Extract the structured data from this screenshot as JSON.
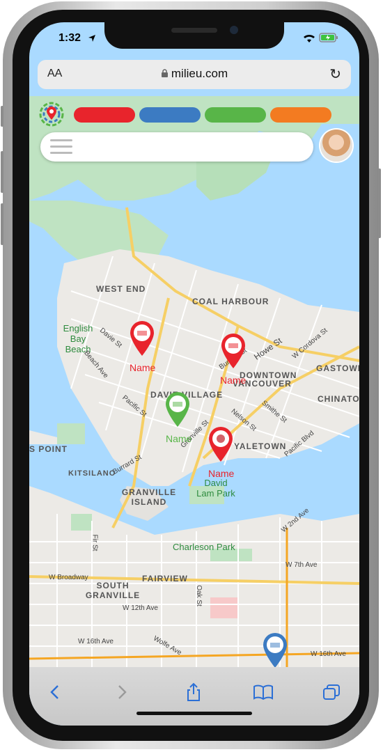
{
  "status_bar": {
    "time": "1:32"
  },
  "browser": {
    "text_size_label": "AA",
    "url": "milieu.com"
  },
  "filters": {
    "categories": [
      {
        "color": "#e8242c"
      },
      {
        "color": "#3c7bc2"
      },
      {
        "color": "#58b548"
      },
      {
        "color": "#f37b21"
      }
    ]
  },
  "map": {
    "neighborhoods": [
      {
        "id": "west-end",
        "label": "WEST END"
      },
      {
        "id": "coal-harbour",
        "label": "COAL HARBOUR"
      },
      {
        "id": "downtown",
        "label": "DOWNTOWN"
      },
      {
        "id": "vancouver",
        "label": "VANCOUVER"
      },
      {
        "id": "gastown",
        "label": "GASTOWN"
      },
      {
        "id": "chinatown",
        "label": "CHINATOWN"
      },
      {
        "id": "davie-village",
        "label": "DAVIE VILLAGE"
      },
      {
        "id": "yaletown",
        "label": "YALETOWN"
      },
      {
        "id": "kitsilano",
        "label": "KITSILANO"
      },
      {
        "id": "s-point",
        "label": "S POINT"
      },
      {
        "id": "granville-island",
        "label": "GRANVILLE ISLAND"
      },
      {
        "id": "fairview",
        "label": "FAIRVIEW"
      },
      {
        "id": "south-granville",
        "label": "SOUTH GRANVILLE"
      }
    ],
    "parks": [
      {
        "id": "english-bay",
        "label": "English Bay Beach"
      },
      {
        "id": "david-lam",
        "label": "David Lam Park"
      },
      {
        "id": "charleson",
        "label": "Charleson Park"
      }
    ],
    "streets": [
      {
        "id": "w-broadway",
        "label": "W Broadway"
      },
      {
        "id": "w-7th",
        "label": "W 7th Ave"
      },
      {
        "id": "w-12th",
        "label": "W 12th Ave"
      },
      {
        "id": "w-16th",
        "label": "W 16th Ave"
      },
      {
        "id": "w-16th-e",
        "label": "W 16th Ave"
      },
      {
        "id": "wolfe",
        "label": "Wolfe Ave"
      },
      {
        "id": "howe",
        "label": "Howe St"
      },
      {
        "id": "burrard",
        "label": "Burrard St"
      },
      {
        "id": "burrard-br",
        "label": "Burrard St"
      },
      {
        "id": "davie",
        "label": "Davie St"
      },
      {
        "id": "pacific",
        "label": "Pacific St"
      },
      {
        "id": "granville-st",
        "label": "Granville St"
      },
      {
        "id": "nelson",
        "label": "Nelson St"
      },
      {
        "id": "smithe",
        "label": "Smithe St"
      },
      {
        "id": "pacific-blvd",
        "label": "Pacific Blvd"
      },
      {
        "id": "w-cordova",
        "label": "W Cordova St"
      },
      {
        "id": "w-2nd",
        "label": "W 2nd Ave"
      },
      {
        "id": "oak",
        "label": "Oak St"
      },
      {
        "id": "fir",
        "label": "Fir St"
      },
      {
        "id": "beach",
        "label": "Beach Ave"
      }
    ],
    "pins": [
      {
        "id": "pin-1",
        "color": "#e8242c",
        "name": "Name"
      },
      {
        "id": "pin-2",
        "color": "#e8242c",
        "name": "Name"
      },
      {
        "id": "pin-3",
        "color": "#58b548",
        "name": "Name"
      },
      {
        "id": "pin-4",
        "color": "#e8242c",
        "name": "Name"
      },
      {
        "id": "pin-5",
        "color": "#3c7bc2",
        "name": ""
      }
    ]
  }
}
